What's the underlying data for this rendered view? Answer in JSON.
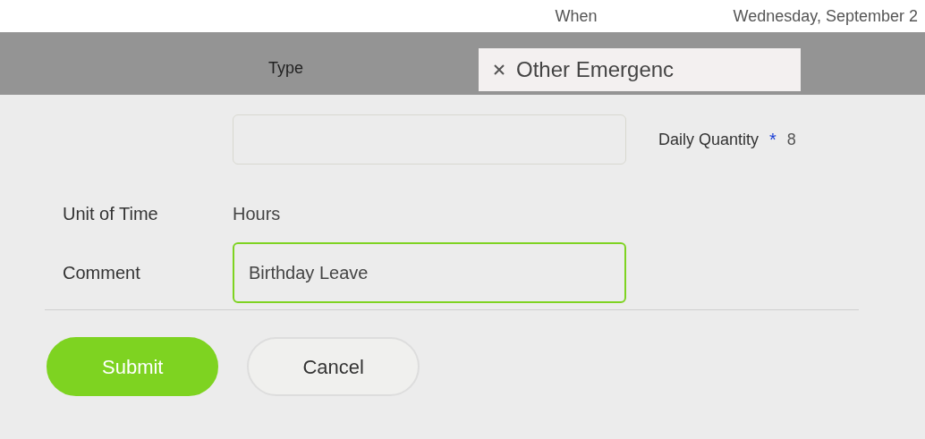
{
  "header": {
    "when_label": "When",
    "date": "Wednesday, September 2"
  },
  "type_row": {
    "label": "Type",
    "chip": "Other Emergenc"
  },
  "quantity": {
    "label": "Daily Quantity",
    "required_mark": "*",
    "value": "8"
  },
  "fields": [
    {
      "kind": "text",
      "label": "Unit of Time",
      "value": "Hours"
    },
    {
      "kind": "input",
      "label": "Comment",
      "value": "Birthday Leave",
      "focused": true
    }
  ],
  "buttons": [
    {
      "label": "Submit",
      "kind": "primary"
    },
    {
      "label": "Cancel",
      "kind": "secondary"
    }
  ]
}
